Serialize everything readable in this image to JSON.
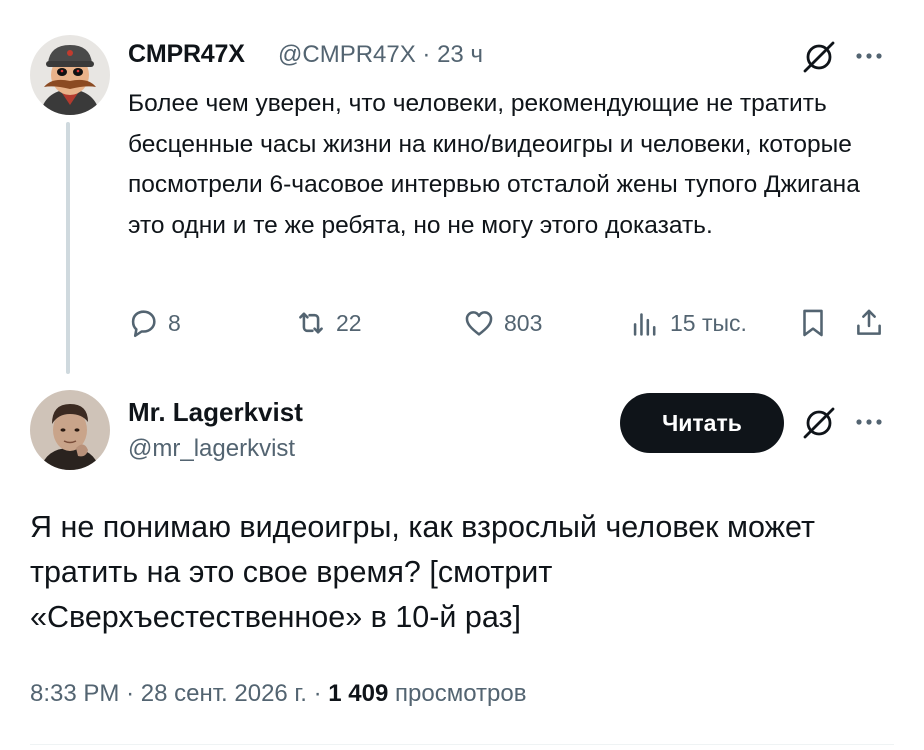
{
  "tweet1": {
    "display_name": "CMPR47X",
    "handle": "@CMPR47X",
    "separator": "·",
    "time": "23 ч",
    "text": "Более чем уверен, что человеки, рекомендующие не тратить бесценные часы жизни на кино/видеоигры и человеки, которые посмотрели 6-часовое интервью отсталой жены тупого Джигана это одни и те же ребята, но не могу этого доказать.",
    "stats": {
      "replies": "8",
      "retweets": "22",
      "likes": "803",
      "views": "15 тыс."
    },
    "icons": [
      "grok-icon",
      "more-icon",
      "reply-icon",
      "retweet-icon",
      "like-icon",
      "views-icon",
      "bookmark-icon",
      "share-icon"
    ]
  },
  "tweet2": {
    "display_name": "Mr. Lagerkvist",
    "handle": "@mr_lagerkvist",
    "follow_label": "Читать",
    "text": "Я не понимаю видеоигры, как взрослый человек может тратить на это свое время? [смотрит «Сверхъестественное» в 10-й раз]",
    "meta": {
      "time": "8:33 PM",
      "separator": "·",
      "date": "28 сент. 2026 г.",
      "views_count": "1 409",
      "views_label": "просмотров"
    }
  },
  "colors": {
    "text": "#0f1419",
    "muted": "#536471",
    "thread_line": "#cfd9de",
    "button_bg": "#0f1419",
    "button_text": "#ffffff"
  }
}
